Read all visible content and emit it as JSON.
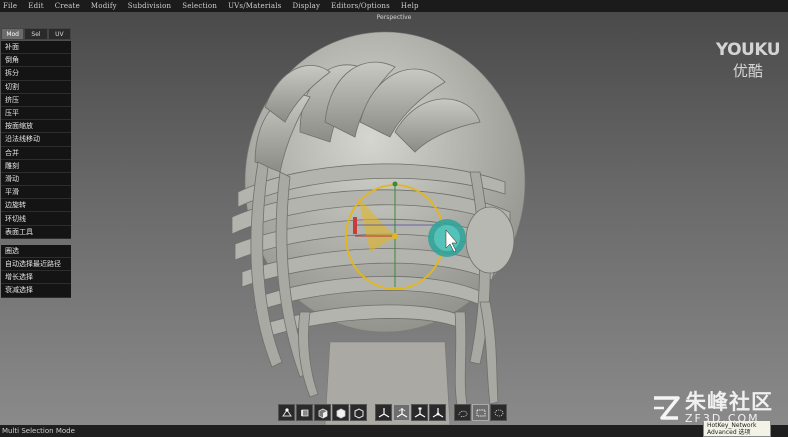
{
  "menu": [
    "File",
    "Edit",
    "Create",
    "Modify",
    "Subdivision",
    "Selection",
    "UVs/Materials",
    "Display",
    "Editors/Options",
    "Help"
  ],
  "viewport": {
    "title": "Perspective"
  },
  "watermark_top": {
    "logo": "YOUKU",
    "sub": "优酷"
  },
  "tool_panel": {
    "tabs": [
      "Mod",
      "Sel",
      "UV"
    ],
    "active_tab": "Mod",
    "tools": [
      "补面",
      "倒角",
      "拆分",
      "切割",
      "挤压",
      "压平",
      "按面缩放",
      "沿法线移动",
      "合并",
      "雕刻",
      "滑动",
      "平滑",
      "边旋转",
      "环切线",
      "表面工具"
    ],
    "select_tools": [
      "圈选",
      "自动选择最近路径",
      "增长选择",
      "衰减选择"
    ]
  },
  "icon_bar": [
    {
      "icon": "vertex-mode-icon",
      "selected": false
    },
    {
      "icon": "edge-mode-icon",
      "selected": false
    },
    {
      "icon": "face-mode-icon",
      "selected": false
    },
    {
      "icon": "object-mode-icon",
      "selected": false
    },
    {
      "icon": "uv-mode-icon",
      "selected": false
    },
    {
      "icon": "move-tool-icon",
      "selected": false
    },
    {
      "icon": "rotate-tool-icon",
      "selected": true
    },
    {
      "icon": "scale-tool-icon",
      "selected": false
    },
    {
      "icon": "universal-tool-icon",
      "selected": false
    },
    {
      "icon": "lasso-select-icon",
      "selected": false
    },
    {
      "icon": "marquee-select-icon",
      "selected": true
    },
    {
      "icon": "paint-select-icon",
      "selected": false
    }
  ],
  "status": {
    "text": "Multi Selection Mode"
  },
  "tooltip": {
    "line1": "HotKey_Network",
    "line2": "Advanced 选项"
  },
  "watermark_bottom": {
    "main": "朱峰社区",
    "sub": "ZF3D.COM"
  },
  "colors": {
    "menubar": "#1b1b1b",
    "panel_button": "#141414",
    "gizmo_ring": "#e3b71a",
    "gizmo_sphere": "#2aa39a",
    "mesh": "#b4b4ae"
  }
}
